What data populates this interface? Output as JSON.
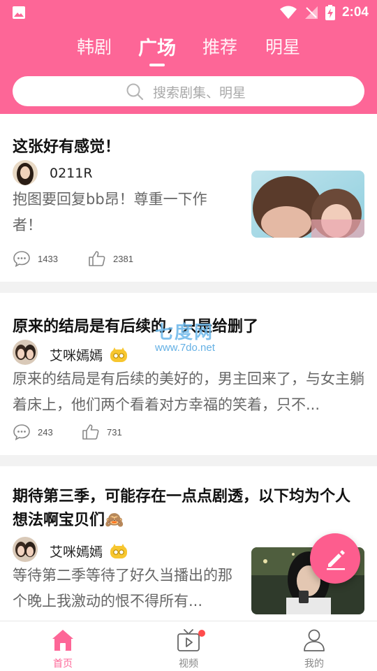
{
  "status_bar": {
    "time": "2:04"
  },
  "tabs": [
    {
      "label": "韩剧",
      "active": false
    },
    {
      "label": "广场",
      "active": true
    },
    {
      "label": "推荐",
      "active": false
    },
    {
      "label": "明星",
      "active": false
    }
  ],
  "search": {
    "placeholder": "搜索剧集、明星"
  },
  "posts": [
    {
      "title": "这张好有感觉！",
      "author": "0211R",
      "vip": false,
      "excerpt": "抱图要回复bb昂！尊重一下作者！",
      "comments": "1433",
      "likes": "2381",
      "has_image": true
    },
    {
      "title": "原来的结局是有后续的，只是给删了",
      "author": "艾咪嫣嫣",
      "vip": true,
      "excerpt": "原来的结局是有后续的美好的，男主回来了，与女主躺着床上，他们两个看着对方幸福的笑着，只不...",
      "comments": "243",
      "likes": "731",
      "has_image": false
    },
    {
      "title": "期待第三季，可能存在一点点剧透，以下均为个人想法啊宝贝们🙈",
      "author": "艾咪嫣嫣",
      "vip": true,
      "excerpt": "等待第二季等待了好久当播出的那个晚上我激动的恨不得所有...",
      "has_image": true
    }
  ],
  "watermark": {
    "big": "七度网",
    "small": "www.7do.net"
  },
  "bottom_nav": [
    {
      "label": "首页",
      "icon": "home-icon",
      "active": true
    },
    {
      "label": "视频",
      "icon": "tv-icon",
      "active": false,
      "badge": true
    },
    {
      "label": "我的",
      "icon": "profile-icon",
      "active": false
    }
  ],
  "colors": {
    "primary": "#fd6697",
    "fab": "#fd5d8e",
    "badge": "#ff4c4c"
  }
}
